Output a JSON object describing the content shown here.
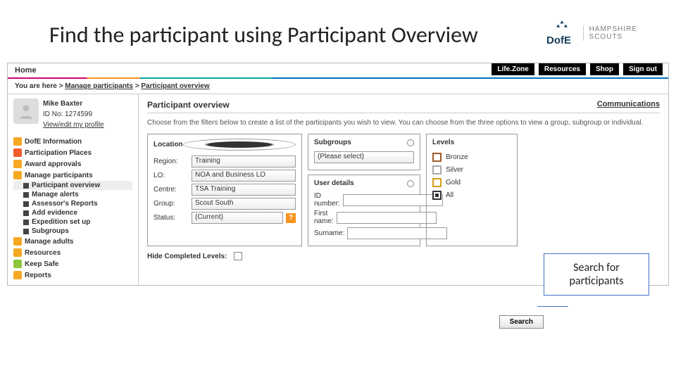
{
  "slide_title": "Find the participant using Participant Overview",
  "logos": {
    "scouts_line1": "HAMPSHIRE",
    "scouts_line2": "SCOUTS"
  },
  "topbar": {
    "home": "Home",
    "links": [
      "Life.Zone",
      "Resources",
      "Shop",
      "Sign out"
    ]
  },
  "breadcrumb": {
    "prefix": "You are here >",
    "l1": "Manage participants",
    "l2": "Participant overview"
  },
  "user": {
    "name": "Mike Baxter",
    "id_label": "ID No: 1274599",
    "profile_link": "View/edit my profile"
  },
  "nav": [
    {
      "label": "DofE Information",
      "color": "#f7a823"
    },
    {
      "label": "Participation Places",
      "color": "#f15a29"
    },
    {
      "label": "Award approvals",
      "color": "#f7a823"
    },
    {
      "label": "Manage participants",
      "color": "#f7a823"
    }
  ],
  "subnav": [
    "Participant overview",
    "Manage alerts",
    "Assessor's Reports",
    "Add evidence",
    "Expedition set up",
    "Subgroups"
  ],
  "nav2": [
    {
      "label": "Manage adults",
      "color": "#f7a823"
    },
    {
      "label": "Resources",
      "color": "#f7a823"
    },
    {
      "label": "Keep Safe",
      "color": "#8dc63f"
    },
    {
      "label": "Reports",
      "color": "#f7a823"
    }
  ],
  "content": {
    "title": "Participant overview",
    "comm_link": "Communications",
    "desc": "Choose from the filters below to create a list of the participants you wish to view. You can choose from the three options to view a group, subgroup or individual."
  },
  "location": {
    "head": "Location",
    "region_l": "Region:",
    "region_v": "Training",
    "lo_l": "LO:",
    "lo_v": "NOA and Business LO",
    "centre_l": "Centre:",
    "centre_v": "TSA Training",
    "group_l": "Group:",
    "group_v": "Scout South",
    "status_l": "Status:",
    "status_v": "(Current)"
  },
  "subgroups": {
    "head": "Subgroups",
    "select": "(Please select)"
  },
  "userdetails": {
    "head": "User details",
    "id_l": "ID number:",
    "fn_l": "First name:",
    "sn_l": "Surname:"
  },
  "levels": {
    "head": "Levels",
    "bronze": "Bronze",
    "silver": "Silver",
    "gold": "Gold",
    "all": "All"
  },
  "hide": {
    "label": "Hide Completed Levels:"
  },
  "search_btn": "Search",
  "callout": "Search for participants"
}
